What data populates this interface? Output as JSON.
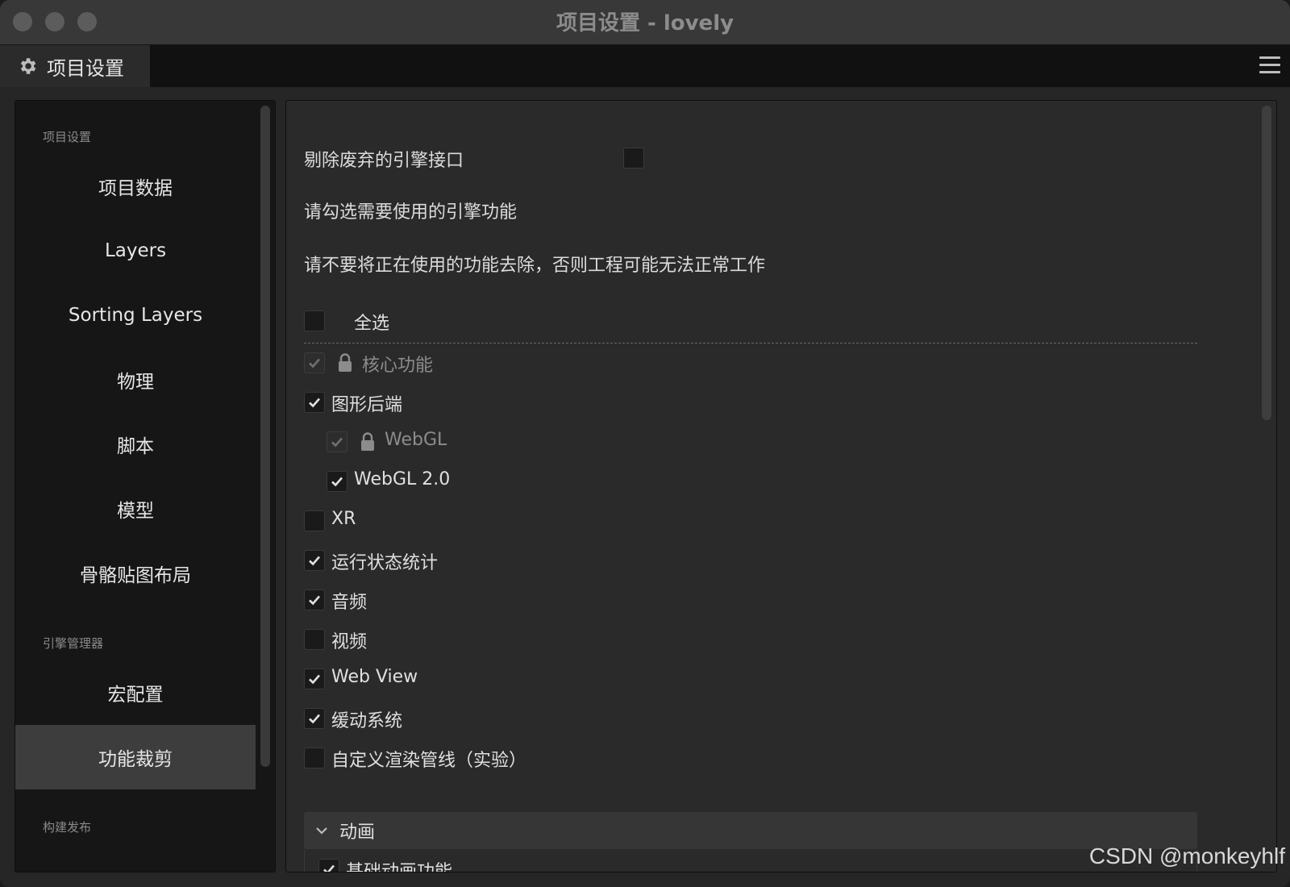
{
  "window": {
    "title": "项目设置 - lovely"
  },
  "tab": {
    "label": "项目设置",
    "icon": "gear-icon"
  },
  "sidebar": {
    "groups": [
      {
        "label": "项目设置"
      },
      {
        "label": "引擎管理器"
      },
      {
        "label": "构建发布"
      }
    ],
    "items": [
      {
        "label": "项目数据"
      },
      {
        "label": "Layers"
      },
      {
        "label": "Sorting Layers"
      },
      {
        "label": "物理"
      },
      {
        "label": "脚本"
      },
      {
        "label": "模型"
      },
      {
        "label": "骨骼贴图布局"
      },
      {
        "label": "宏配置"
      },
      {
        "label": "功能裁剪",
        "active": true
      }
    ]
  },
  "main": {
    "deprecated_label": "剔除废弃的引擎接口",
    "hint1": "请勾选需要使用的引擎功能",
    "hint2": "请不要将正在使用的功能去除，否则工程可能无法正常工作",
    "select_all": "全选",
    "features": [
      {
        "label": "核心功能",
        "checked": true,
        "locked": true
      },
      {
        "label": "图形后端",
        "checked": true
      },
      {
        "label": "WebGL",
        "checked": true,
        "locked": true
      },
      {
        "label": "WebGL 2.0",
        "checked": true
      },
      {
        "label": "XR",
        "checked": false
      },
      {
        "label": "运行状态统计",
        "checked": true
      },
      {
        "label": "音频",
        "checked": true
      },
      {
        "label": "视频",
        "checked": false
      },
      {
        "label": "Web View",
        "checked": true
      },
      {
        "label": "缓动系统",
        "checked": true
      },
      {
        "label": "自定义渲染管线（实验）",
        "checked": false
      }
    ],
    "section": {
      "label": "动画",
      "expanded": true
    },
    "section_items": [
      {
        "label": "基础动画功能",
        "checked": true
      }
    ]
  },
  "watermark": "CSDN @monkeyhlf"
}
